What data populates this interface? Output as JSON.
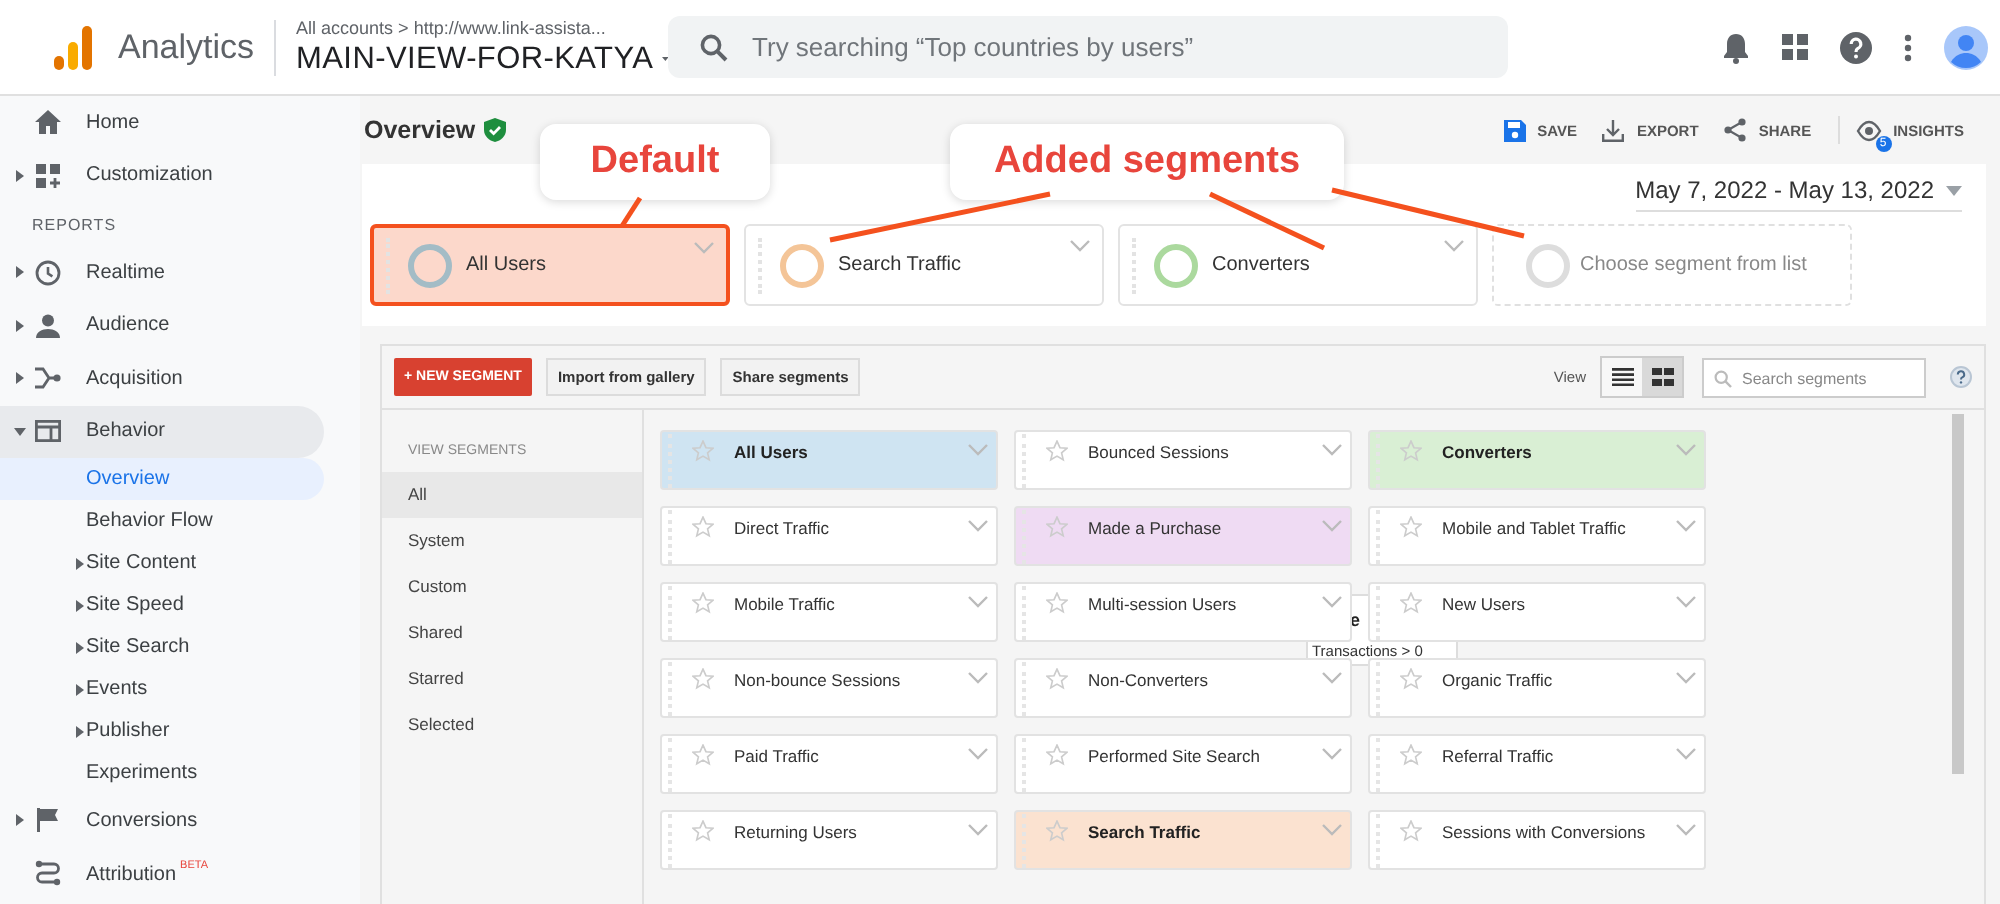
{
  "header": {
    "product": "Analytics",
    "breadcrumb": "All accounts > http://www.link-assista...",
    "view": "MAIN-VIEW-FOR-KATYA",
    "search_placeholder": "Try searching “Top countries by users”"
  },
  "sidebar": {
    "top_items": [
      {
        "label": "Home",
        "kind": "plain"
      },
      {
        "label": "Customization",
        "kind": "expandable",
        "expanded": false
      }
    ],
    "section": "REPORTS",
    "report_items": [
      {
        "label": "Realtime",
        "kind": "expandable",
        "expanded": false
      },
      {
        "label": "Audience",
        "kind": "expandable",
        "expanded": false
      },
      {
        "label": "Acquisition",
        "kind": "expandable",
        "expanded": false
      },
      {
        "label": "Behavior",
        "kind": "expandable",
        "expanded": true,
        "children": [
          {
            "label": "Overview",
            "kind": "plain",
            "selected": true
          },
          {
            "label": "Behavior Flow",
            "kind": "plain",
            "selected": false
          },
          {
            "label": "Site Content",
            "kind": "expandable",
            "selected": false
          },
          {
            "label": "Site Speed",
            "kind": "expandable",
            "selected": false
          },
          {
            "label": "Site Search",
            "kind": "expandable",
            "selected": false
          },
          {
            "label": "Events",
            "kind": "expandable",
            "selected": false
          },
          {
            "label": "Publisher",
            "kind": "expandable",
            "selected": false
          },
          {
            "label": "Experiments",
            "kind": "plain",
            "selected": false
          }
        ]
      },
      {
        "label": "Conversions",
        "kind": "expandable",
        "expanded": false
      },
      {
        "label": "Attribution",
        "kind": "plain",
        "badge": "BETA"
      }
    ]
  },
  "page": {
    "title": "Overview",
    "actions": [
      "SAVE",
      "EXPORT",
      "SHARE",
      "INSIGHTS"
    ],
    "insights_count": "5",
    "date_range": "May 7, 2022 - May 13, 2022"
  },
  "segment_chips": [
    {
      "kind": "segment",
      "name": "All Users",
      "color": "#a3bcc6",
      "highlighted": true
    },
    {
      "kind": "segment",
      "name": "Search Traffic",
      "color": "#f4c598",
      "highlighted": false
    },
    {
      "kind": "segment",
      "name": "Converters",
      "color": "#abd99e",
      "highlighted": false
    },
    {
      "kind": "empty",
      "name": "Choose segment from list",
      "color": "#dddddd",
      "highlighted": false
    }
  ],
  "annotations": [
    {
      "text": "Default"
    },
    {
      "text": "Added segments"
    }
  ],
  "segment_builder": {
    "new_button": "+ NEW SEGMENT",
    "buttons": [
      "Import from gallery",
      "Share segments"
    ],
    "view_label": "View",
    "view_modes": [
      {
        "kind": "list",
        "selected": false
      },
      {
        "kind": "grid",
        "selected": true
      }
    ],
    "search_placeholder": "Search segments",
    "filter_heading": "VIEW SEGMENTS",
    "filters": [
      {
        "label": "All",
        "selected": true
      },
      {
        "label": "System",
        "selected": false
      },
      {
        "label": "Custom",
        "selected": false
      },
      {
        "label": "Shared",
        "selected": false
      },
      {
        "label": "Starred",
        "selected": false
      },
      {
        "label": "Selected",
        "selected": false
      }
    ],
    "segments": [
      {
        "name": "All Users",
        "applied": true,
        "color": "#cfe4f2"
      },
      {
        "name": "Bounced Sessions",
        "applied": false
      },
      {
        "name": "Converters",
        "applied": true,
        "color": "#d9efd4"
      },
      {
        "name": "Direct Traffic",
        "applied": false
      },
      {
        "name": "Made a Purchase",
        "applied": false,
        "color": "#efdbf3"
      },
      {
        "name": "Mobile and Tablet Traffic",
        "applied": false
      },
      {
        "name": "Mobile Traffic",
        "applied": false
      },
      {
        "name": "Multi-session Users",
        "applied": false
      },
      {
        "name": "New Users",
        "applied": false
      },
      {
        "name": "Non-bounce Sessions",
        "applied": false
      },
      {
        "name": "Non-Converters",
        "applied": false
      },
      {
        "name": "Organic Traffic",
        "applied": false
      },
      {
        "name": "Paid Traffic",
        "applied": false
      },
      {
        "name": "Performed Site Search",
        "applied": false
      },
      {
        "name": "Referral Traffic",
        "applied": false
      },
      {
        "name": "Returning Users",
        "applied": false
      },
      {
        "name": "Search Traffic",
        "applied": true,
        "color": "#fbe2d0"
      },
      {
        "name": "Sessions with Conversions",
        "applied": false
      }
    ],
    "hover_popup": {
      "title": "e",
      "text": "Transactions > 0"
    }
  }
}
